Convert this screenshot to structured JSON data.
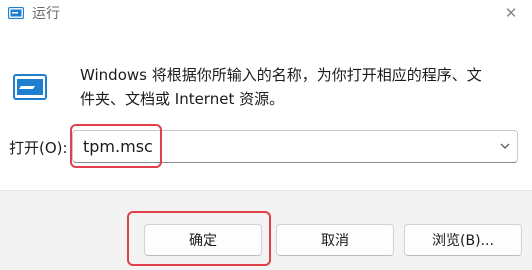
{
  "window": {
    "title": "运行",
    "close_glyph": "✕"
  },
  "body": {
    "description": "Windows 将根据你所输入的名称，为你打开相应的程序、文\n件夹、文档或 Internet 资源。",
    "open_label": "打开(O):",
    "open_value": "tpm.msc"
  },
  "buttons": {
    "ok": "确定",
    "cancel": "取消",
    "browse": "浏览(B)..."
  },
  "icons": {
    "title": "run-icon",
    "main": "run-icon",
    "dropdown": "chevron-down-icon"
  },
  "colors": {
    "highlight": "#e0404a",
    "icon_blue": "#1e7fd1"
  }
}
